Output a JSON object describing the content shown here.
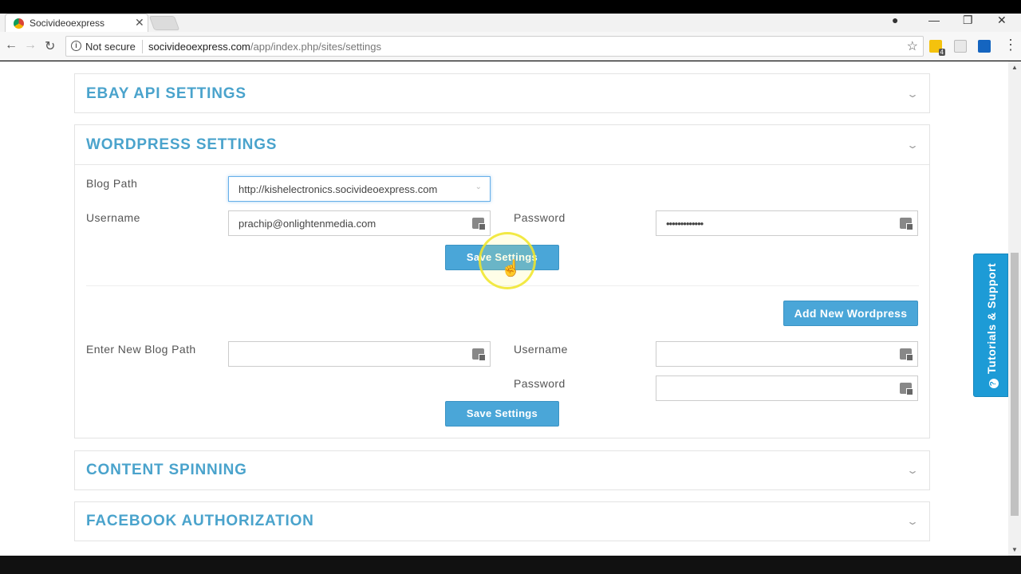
{
  "browser": {
    "tab_title": "Socivideoexpress",
    "tab_close": "✕",
    "not_secure": "Not secure",
    "url_domain": "socivideoexpress.com",
    "url_path": "/app/index.php/sites/settings",
    "extension_badge": "4"
  },
  "panels": {
    "ebay_title": "EBAY API SETTINGS",
    "wordpress_title": "WORDPRESS SETTINGS",
    "content_spinning_title": "CONTENT SPINNING",
    "facebook_title": "FACEBOOK AUTHORIZATION"
  },
  "wordpress": {
    "existing": {
      "blog_path_label": "Blog Path",
      "blog_path_value": "http://kishelectronics.socivideoexpress.com",
      "username_label": "Username",
      "username_value": "prachip@onlightenmedia.com",
      "password_label": "Password",
      "password_value": "•••••••••••••",
      "save_label": "Save Settings"
    },
    "add_new_label": "Add New Wordpress",
    "new_entry": {
      "blog_path_label": "Enter New Blog Path",
      "blog_path_value": "",
      "username_label": "Username",
      "username_value": "",
      "password_label": "Password",
      "password_value": "",
      "save_label": "Save Settings"
    }
  },
  "side_tab": {
    "label": "Tutorials & Support",
    "color": "#1d9bd6"
  },
  "colors": {
    "accent": "#4aa3cc",
    "button": "#4aa6d8"
  }
}
